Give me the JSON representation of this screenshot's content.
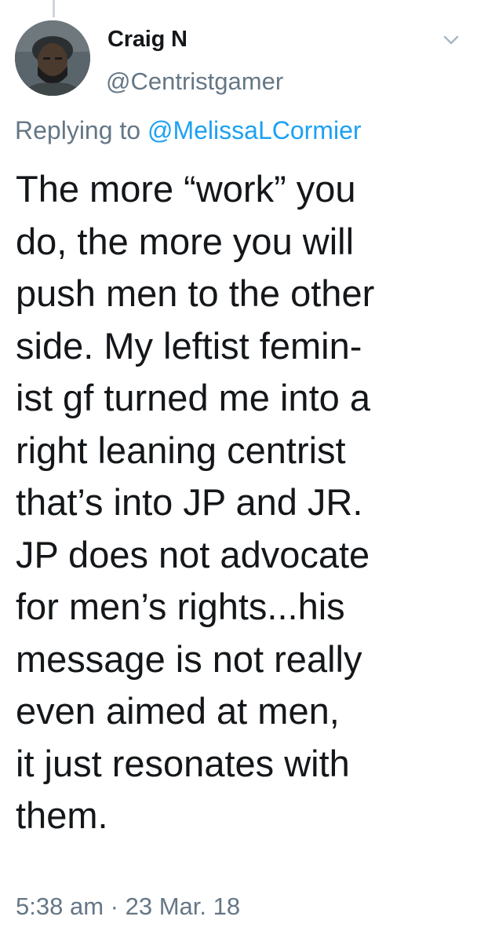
{
  "tweet": {
    "author_name": "Craig N",
    "author_handle": "@Centristgamer",
    "reply_prefix": "Replying to",
    "reply_to_handle": "@MelissaLCormier",
    "text_lines": [
      "The more “work” you",
      "do, the more you will",
      "push men to the other",
      "side. My leftist femin-",
      "ist gf turned me into a",
      "right leaning centrist",
      "that’s into JP and JR.",
      "JP does not advocate",
      "for men’s rights...his",
      "message is not really",
      "even aimed at men,",
      "it just resonates with",
      "them."
    ],
    "time": "5:38 am",
    "separator": "·",
    "date": "23 Mar. 18"
  },
  "icons": {
    "menu": "chevron-down-icon",
    "avatar": "avatar"
  },
  "colors": {
    "text": "#14171a",
    "muted": "#657786",
    "link": "#1da1f2",
    "thread_line": "#ccd6dd",
    "background": "#ffffff"
  }
}
